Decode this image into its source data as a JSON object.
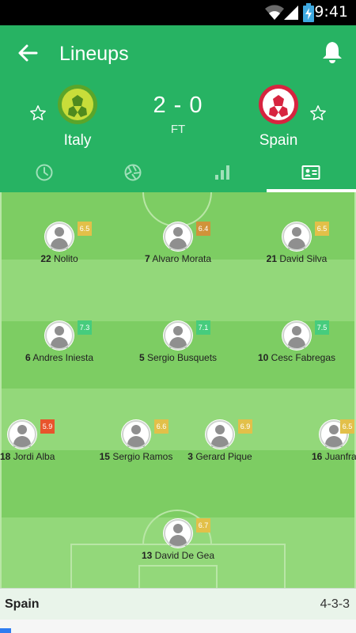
{
  "status_bar": {
    "time": "9:41"
  },
  "app_bar": {
    "title": "Lineups"
  },
  "match": {
    "home_team": "Italy",
    "away_team": "Spain",
    "score": "2 - 0",
    "status": "FT"
  },
  "tabs": [
    "timeline-icon",
    "stats-pie-icon",
    "bar-chart-icon",
    "lineup-card-icon"
  ],
  "colors": {
    "primary": "#27b363",
    "pitch_dark": "#7dcd63",
    "pitch_light": "#93d87a"
  },
  "players": [
    {
      "number": "22",
      "name": "Nolito",
      "rating": "6.5",
      "color": "#e2c049"
    },
    {
      "number": "7",
      "name": "Alvaro Morata",
      "rating": "6.4",
      "color": "#d0933a"
    },
    {
      "number": "21",
      "name": "David Silva",
      "rating": "6.5",
      "color": "#e2c049"
    },
    {
      "number": "6",
      "name": "Andres Iniesta",
      "rating": "7.3",
      "color": "#46cc7d"
    },
    {
      "number": "5",
      "name": "Sergio Busquets",
      "rating": "7.1",
      "color": "#46cc7d"
    },
    {
      "number": "10",
      "name": "Cesc Fabregas",
      "rating": "7.5",
      "color": "#46cc7d"
    },
    {
      "number": "18",
      "name": "Jordi Alba",
      "rating": "5.9",
      "color": "#e8542c"
    },
    {
      "number": "15",
      "name": "Sergio Ramos",
      "rating": "6.6",
      "color": "#e2c049"
    },
    {
      "number": "3",
      "name": "Gerard Pique",
      "rating": "6.9",
      "color": "#e2c049"
    },
    {
      "number": "16",
      "name": "Juanfran",
      "rating": "6.5",
      "color": "#e2c049"
    },
    {
      "number": "13",
      "name": "David De Gea",
      "rating": "6.7",
      "color": "#e2c049"
    }
  ],
  "footer": {
    "team": "Spain",
    "formation": "4-3-3"
  }
}
